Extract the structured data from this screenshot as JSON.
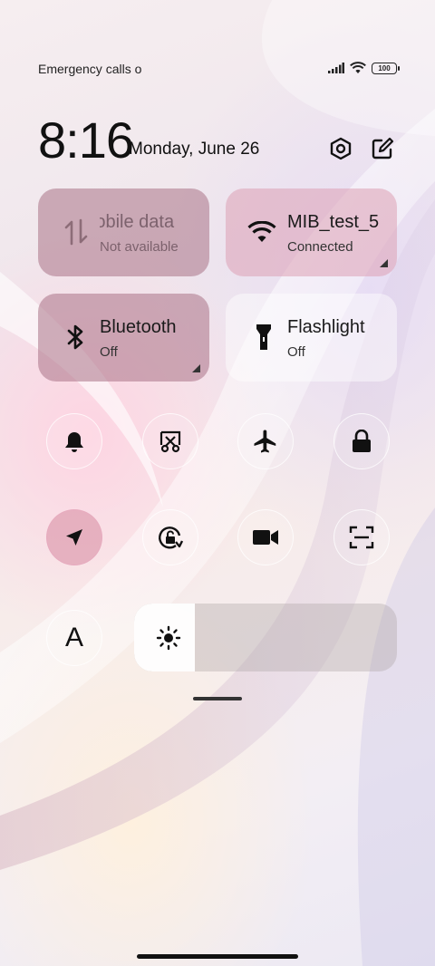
{
  "status_bar": {
    "carrier_text": "Emergency calls o",
    "battery": "100",
    "icons": [
      "signal-icon",
      "wifi-icon",
      "battery-icon"
    ]
  },
  "header": {
    "time": "8:16",
    "date": "Monday, June 26",
    "icons": [
      "settings-icon",
      "edit-icon"
    ]
  },
  "tiles": [
    {
      "name": "mobile-data",
      "title": "Mobile data",
      "display_title": " obile data",
      "subtitle": "Not available",
      "icon": "mobile-data-icon",
      "state": "disabled"
    },
    {
      "name": "wifi",
      "title": "MIB_test_5",
      "subtitle": "Connected",
      "icon": "wifi-icon",
      "state": "on"
    },
    {
      "name": "bluetooth",
      "title": "Bluetooth",
      "subtitle": "Off",
      "icon": "bluetooth-icon",
      "state": "off"
    },
    {
      "name": "flashlight",
      "title": "Flashlight",
      "subtitle": "Off",
      "icon": "flashlight-icon",
      "state": "off"
    }
  ],
  "toggles": [
    {
      "name": "sound",
      "icon": "bell-icon",
      "active": false
    },
    {
      "name": "screenshot",
      "icon": "screenshot-scissors-icon",
      "active": false
    },
    {
      "name": "airplane-mode",
      "icon": "airplane-icon",
      "active": false
    },
    {
      "name": "lock-screen",
      "icon": "lock-icon",
      "active": false
    },
    {
      "name": "location",
      "icon": "location-arrow-icon",
      "active": true
    },
    {
      "name": "rotation-lock",
      "icon": "rotation-lock-icon",
      "active": false
    },
    {
      "name": "screen-recorder",
      "icon": "video-camera-icon",
      "active": false
    },
    {
      "name": "scanner",
      "icon": "scan-icon",
      "active": false
    },
    {
      "name": "reading-mode",
      "icon": "font-a-icon",
      "label": "A",
      "active": false
    }
  ],
  "brightness": {
    "level": 0.23,
    "icon": "sun-icon"
  }
}
